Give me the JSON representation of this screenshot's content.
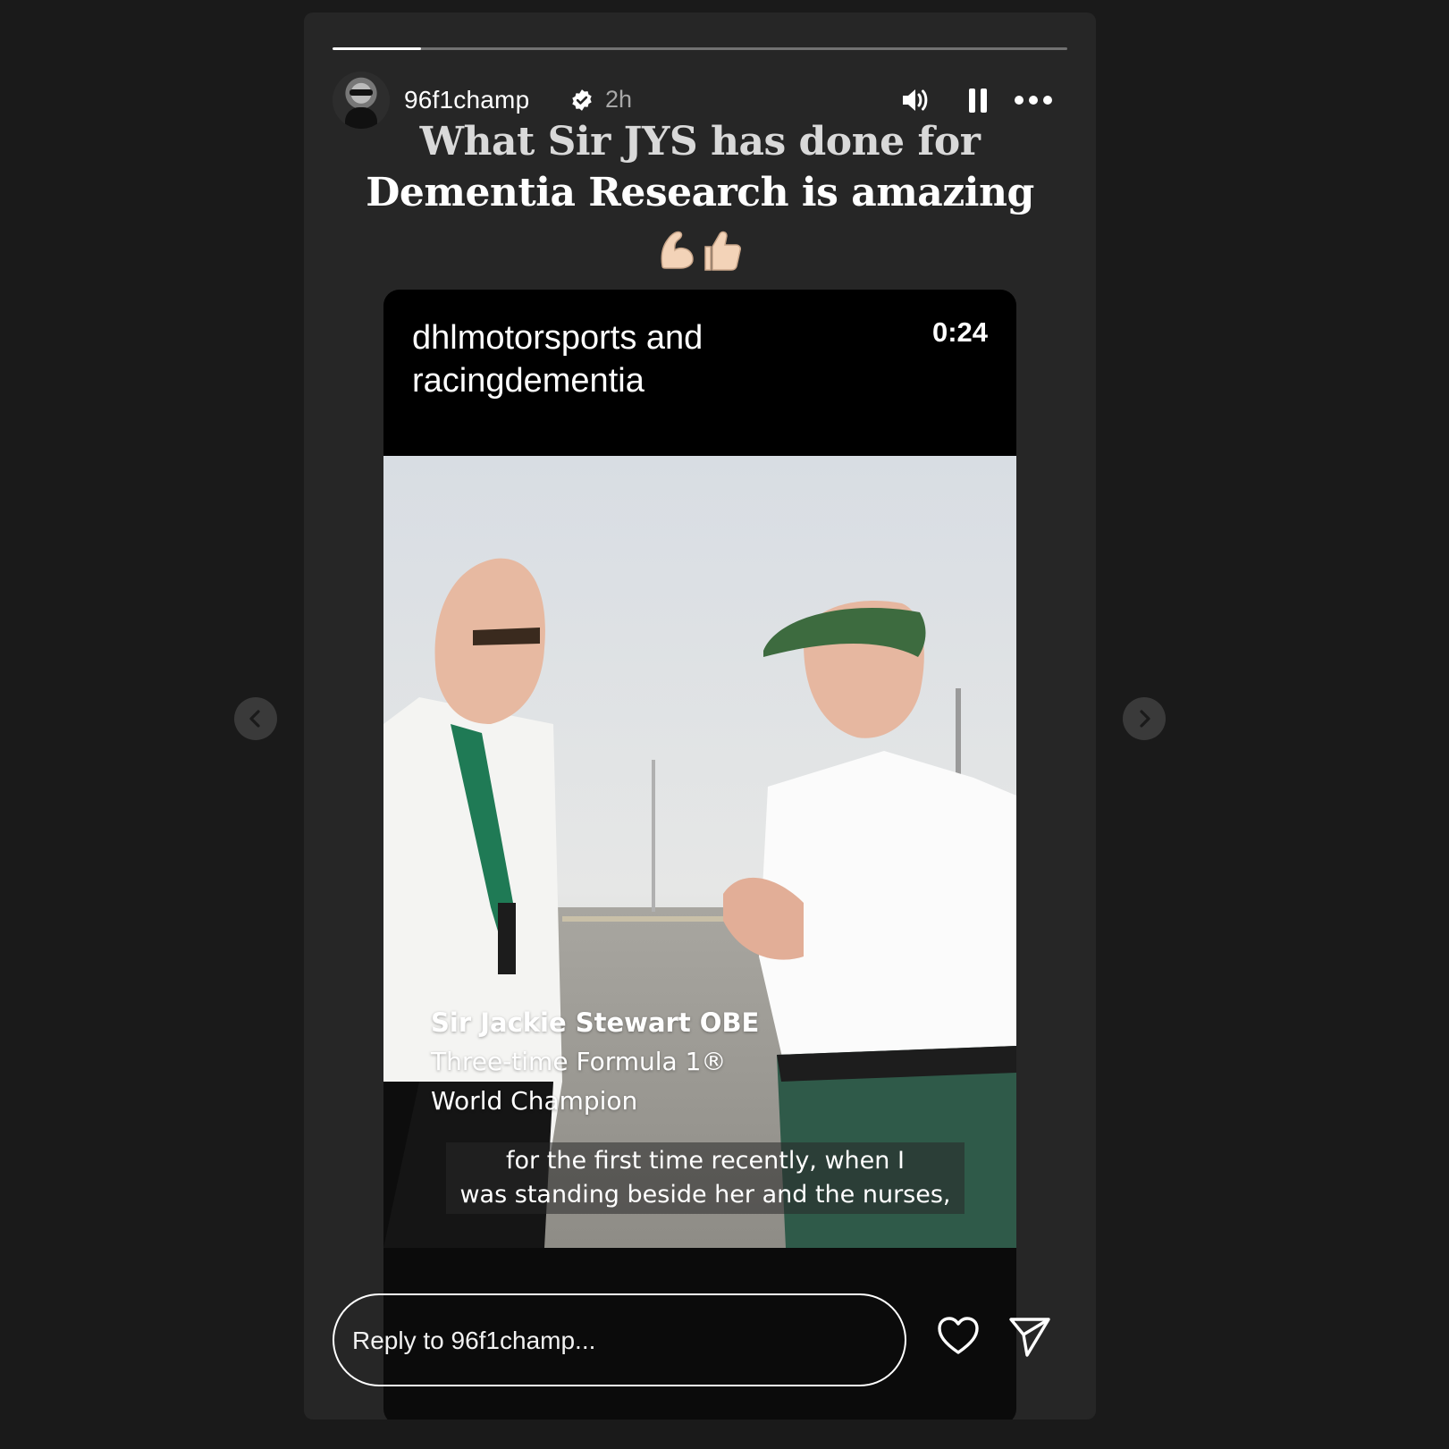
{
  "story": {
    "progress_fraction": 0.12,
    "username": "96f1champ",
    "time_ago": "2h",
    "caption": {
      "line1": "What Sir JYS has done for",
      "line2": "Dementia Research is amazing",
      "emojis": "💪🏻👍🏻"
    },
    "icons": {
      "verified": "verified-badge-icon",
      "volume": "volume-icon",
      "pause": "pause-icon",
      "more": "more-options-icon"
    }
  },
  "shared_post": {
    "author": "dhlmotorsports and racingdementia",
    "duration": "0:24",
    "lower_third": {
      "name": "Sir Jackie Stewart OBE",
      "title_line1": "Three-time Formula 1®",
      "title_line2": "World Champion"
    },
    "subtitle": {
      "line1": "for the first time recently, when I",
      "line2": "was standing beside her and the nurses,"
    }
  },
  "reply": {
    "placeholder": "Reply to 96f1champ..."
  },
  "colors": {
    "page_background": "#1a1a1a",
    "story_background": "#262626",
    "text_primary": "#ffffff",
    "text_secondary": "#a8a8a8",
    "verified": "#ffffff"
  }
}
